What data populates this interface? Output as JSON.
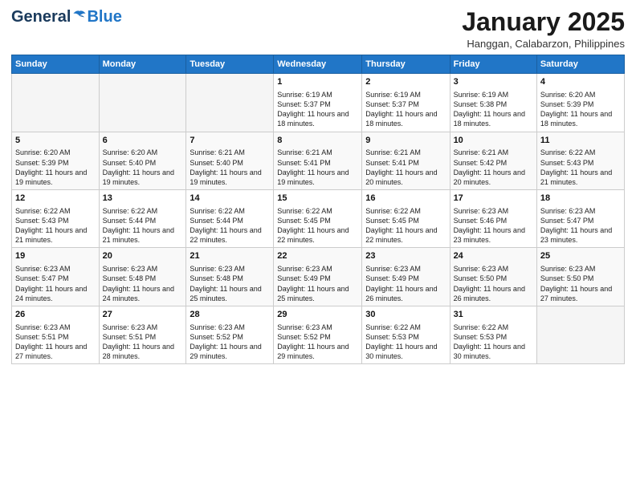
{
  "header": {
    "logo_general": "General",
    "logo_blue": "Blue",
    "month_title": "January 2025",
    "location": "Hanggan, Calabarzon, Philippines"
  },
  "weekdays": [
    "Sunday",
    "Monday",
    "Tuesday",
    "Wednesday",
    "Thursday",
    "Friday",
    "Saturday"
  ],
  "weeks": [
    [
      {
        "day": "",
        "info": ""
      },
      {
        "day": "",
        "info": ""
      },
      {
        "day": "",
        "info": ""
      },
      {
        "day": "1",
        "info": "Sunrise: 6:19 AM\nSunset: 5:37 PM\nDaylight: 11 hours and 18 minutes."
      },
      {
        "day": "2",
        "info": "Sunrise: 6:19 AM\nSunset: 5:37 PM\nDaylight: 11 hours and 18 minutes."
      },
      {
        "day": "3",
        "info": "Sunrise: 6:19 AM\nSunset: 5:38 PM\nDaylight: 11 hours and 18 minutes."
      },
      {
        "day": "4",
        "info": "Sunrise: 6:20 AM\nSunset: 5:39 PM\nDaylight: 11 hours and 18 minutes."
      }
    ],
    [
      {
        "day": "5",
        "info": "Sunrise: 6:20 AM\nSunset: 5:39 PM\nDaylight: 11 hours and 19 minutes."
      },
      {
        "day": "6",
        "info": "Sunrise: 6:20 AM\nSunset: 5:40 PM\nDaylight: 11 hours and 19 minutes."
      },
      {
        "day": "7",
        "info": "Sunrise: 6:21 AM\nSunset: 5:40 PM\nDaylight: 11 hours and 19 minutes."
      },
      {
        "day": "8",
        "info": "Sunrise: 6:21 AM\nSunset: 5:41 PM\nDaylight: 11 hours and 19 minutes."
      },
      {
        "day": "9",
        "info": "Sunrise: 6:21 AM\nSunset: 5:41 PM\nDaylight: 11 hours and 20 minutes."
      },
      {
        "day": "10",
        "info": "Sunrise: 6:21 AM\nSunset: 5:42 PM\nDaylight: 11 hours and 20 minutes."
      },
      {
        "day": "11",
        "info": "Sunrise: 6:22 AM\nSunset: 5:43 PM\nDaylight: 11 hours and 21 minutes."
      }
    ],
    [
      {
        "day": "12",
        "info": "Sunrise: 6:22 AM\nSunset: 5:43 PM\nDaylight: 11 hours and 21 minutes."
      },
      {
        "day": "13",
        "info": "Sunrise: 6:22 AM\nSunset: 5:44 PM\nDaylight: 11 hours and 21 minutes."
      },
      {
        "day": "14",
        "info": "Sunrise: 6:22 AM\nSunset: 5:44 PM\nDaylight: 11 hours and 22 minutes."
      },
      {
        "day": "15",
        "info": "Sunrise: 6:22 AM\nSunset: 5:45 PM\nDaylight: 11 hours and 22 minutes."
      },
      {
        "day": "16",
        "info": "Sunrise: 6:22 AM\nSunset: 5:45 PM\nDaylight: 11 hours and 22 minutes."
      },
      {
        "day": "17",
        "info": "Sunrise: 6:23 AM\nSunset: 5:46 PM\nDaylight: 11 hours and 23 minutes."
      },
      {
        "day": "18",
        "info": "Sunrise: 6:23 AM\nSunset: 5:47 PM\nDaylight: 11 hours and 23 minutes."
      }
    ],
    [
      {
        "day": "19",
        "info": "Sunrise: 6:23 AM\nSunset: 5:47 PM\nDaylight: 11 hours and 24 minutes."
      },
      {
        "day": "20",
        "info": "Sunrise: 6:23 AM\nSunset: 5:48 PM\nDaylight: 11 hours and 24 minutes."
      },
      {
        "day": "21",
        "info": "Sunrise: 6:23 AM\nSunset: 5:48 PM\nDaylight: 11 hours and 25 minutes."
      },
      {
        "day": "22",
        "info": "Sunrise: 6:23 AM\nSunset: 5:49 PM\nDaylight: 11 hours and 25 minutes."
      },
      {
        "day": "23",
        "info": "Sunrise: 6:23 AM\nSunset: 5:49 PM\nDaylight: 11 hours and 26 minutes."
      },
      {
        "day": "24",
        "info": "Sunrise: 6:23 AM\nSunset: 5:50 PM\nDaylight: 11 hours and 26 minutes."
      },
      {
        "day": "25",
        "info": "Sunrise: 6:23 AM\nSunset: 5:50 PM\nDaylight: 11 hours and 27 minutes."
      }
    ],
    [
      {
        "day": "26",
        "info": "Sunrise: 6:23 AM\nSunset: 5:51 PM\nDaylight: 11 hours and 27 minutes."
      },
      {
        "day": "27",
        "info": "Sunrise: 6:23 AM\nSunset: 5:51 PM\nDaylight: 11 hours and 28 minutes."
      },
      {
        "day": "28",
        "info": "Sunrise: 6:23 AM\nSunset: 5:52 PM\nDaylight: 11 hours and 29 minutes."
      },
      {
        "day": "29",
        "info": "Sunrise: 6:23 AM\nSunset: 5:52 PM\nDaylight: 11 hours and 29 minutes."
      },
      {
        "day": "30",
        "info": "Sunrise: 6:22 AM\nSunset: 5:53 PM\nDaylight: 11 hours and 30 minutes."
      },
      {
        "day": "31",
        "info": "Sunrise: 6:22 AM\nSunset: 5:53 PM\nDaylight: 11 hours and 30 minutes."
      },
      {
        "day": "",
        "info": ""
      }
    ]
  ]
}
